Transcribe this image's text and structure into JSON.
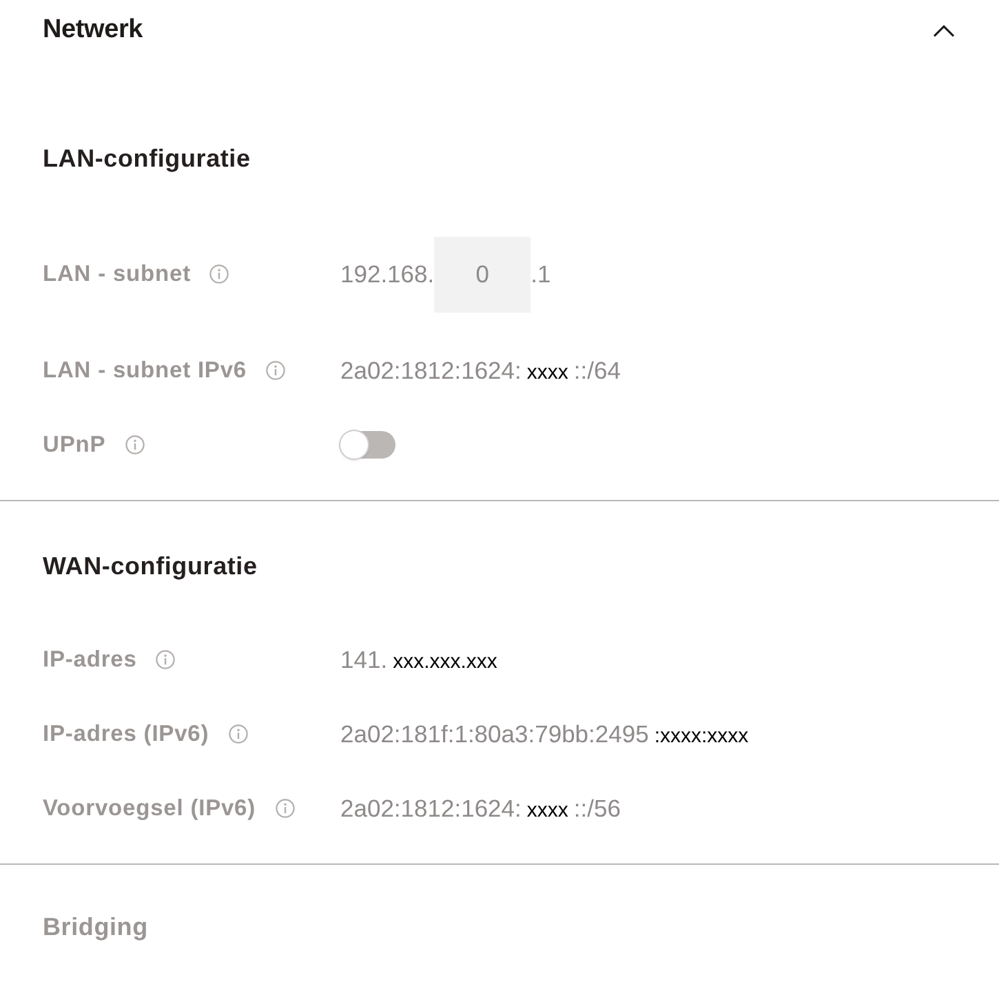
{
  "panel": {
    "title": "Netwerk",
    "expanded": true
  },
  "sections": [
    {
      "title": "LAN-configuratie",
      "disabled": false,
      "rows": [
        {
          "kind": "ip-field",
          "label": "LAN - subnet",
          "prefix": "192.168.",
          "field_value": "0",
          "suffix": ".1"
        },
        {
          "kind": "text",
          "label": "LAN - subnet IPv6",
          "value": [
            {
              "text": "2a02:1812:1624:",
              "redacted": false
            },
            {
              "text": "xxxx",
              "redacted": true
            },
            {
              "text": "::/64",
              "redacted": false
            }
          ]
        },
        {
          "kind": "toggle",
          "label": "UPnP",
          "on": false
        }
      ]
    },
    {
      "title": "WAN-configuratie",
      "disabled": false,
      "rows": [
        {
          "kind": "text",
          "label": "IP-adres",
          "value": [
            {
              "text": "141.",
              "redacted": false
            },
            {
              "text": "xxx.xxx.xxx",
              "redacted": true
            }
          ]
        },
        {
          "kind": "text",
          "label": "IP-adres (IPv6)",
          "value": [
            {
              "text": "2a02:181f:1:80a3:79bb:2495",
              "redacted": false
            },
            {
              "text": ":xxxx:xxxx",
              "redacted": true
            }
          ]
        },
        {
          "kind": "text",
          "label": "Voorvoegsel (IPv6)",
          "value": [
            {
              "text": "2a02:1812:1624:",
              "redacted": false
            },
            {
              "text": "xxxx",
              "redacted": true
            },
            {
              "text": "::/56",
              "redacted": false
            }
          ]
        }
      ]
    },
    {
      "title": "Bridging",
      "disabled": true
    }
  ]
}
